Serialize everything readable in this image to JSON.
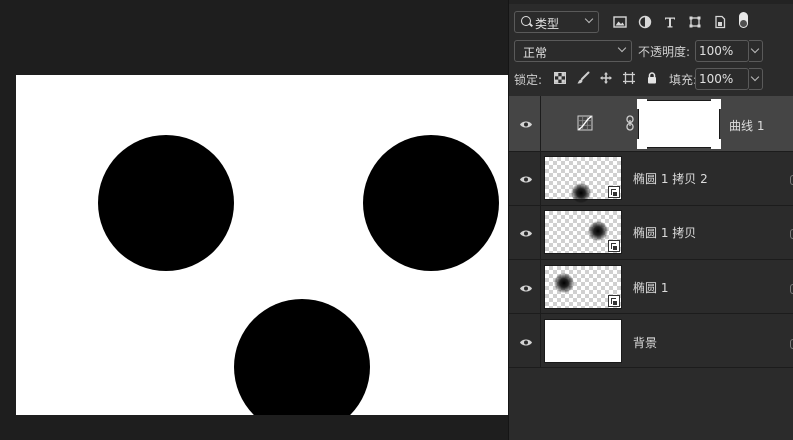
{
  "canvas": {
    "background": "#ffffff",
    "dot_color": "#000000",
    "dots": 3
  },
  "layers_panel": {
    "filter": {
      "kind_label": "类型"
    },
    "filter_icons": [
      "image-icon",
      "adjustment-icon",
      "type-icon",
      "shape-icon",
      "smart-object-icon"
    ],
    "blend_mode": "正常",
    "opacity_label": "不透明度:",
    "opacity_value": "100%",
    "lock_label": "锁定:",
    "lock_icons": [
      "lock-transparent-icon",
      "lock-image-icon",
      "lock-position-icon",
      "lock-artboard-icon",
      "lock-all-icon"
    ],
    "fill_label": "填充:",
    "fill_value": "100%",
    "layers": [
      {
        "name": "曲线 1",
        "type": "adjustment",
        "selected": true
      },
      {
        "name": "椭圆 1 拷贝 2",
        "type": "smart-object"
      },
      {
        "name": "椭圆 1 拷贝",
        "type": "smart-object"
      },
      {
        "name": "椭圆 1",
        "type": "smart-object"
      },
      {
        "name": "背景",
        "type": "background"
      }
    ]
  },
  "colors": {
    "panel_bg": "#2b2b2b",
    "selected_layer": "#454545",
    "workspace": "#1e1e1e"
  }
}
